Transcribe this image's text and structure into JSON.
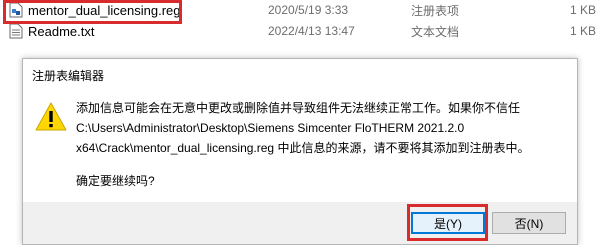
{
  "files": [
    {
      "name": "mentor_dual_licensing.reg",
      "date": "2020/5/19 3:33",
      "type": "注册表项",
      "size": "1 KB",
      "icon": "registry-file-icon"
    },
    {
      "name": "Readme.txt",
      "date": "2022/4/13 13:47",
      "type": "文本文档",
      "size": "1 KB",
      "icon": "text-file-icon"
    }
  ],
  "dialog": {
    "title": "注册表编辑器",
    "message_lines": [
      "添加信息可能会在无意中更改或删除值并导致组件无法继续正常工作。如果你不信任",
      "C:\\Users\\Administrator\\Desktop\\Siemens Simcenter FloTHERM 2021.2.0",
      "x64\\Crack\\mentor_dual_licensing.reg 中此信息的来源，请不要将其添加到注册表中。"
    ],
    "confirm": "确定要继续吗?",
    "yes_label": "是(Y)",
    "no_label": "否(N)",
    "icon": "warning-icon"
  },
  "colors": {
    "highlight": "#d92b2b",
    "warning_yellow": "#ffd700",
    "accent": "#0078d7"
  }
}
